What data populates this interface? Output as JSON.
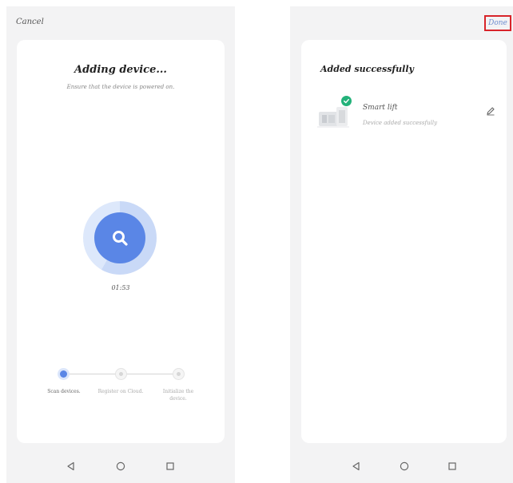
{
  "left_screen": {
    "cancel_label": "Cancel",
    "title": "Adding device...",
    "subtitle": "Ensure that the device is powered on.",
    "timer": "01:53",
    "steps": [
      {
        "label": "Scan devices.",
        "state": "active"
      },
      {
        "label": "Register on Cloud.",
        "state": "pending"
      },
      {
        "label": "Initialize the device.",
        "state": "pending"
      }
    ]
  },
  "right_screen": {
    "done_label": "Done",
    "title": "Added successfully",
    "device": {
      "name": "Smart lift",
      "status": "Device added successfully"
    }
  },
  "icons": {
    "scan": "magnifier-icon",
    "success": "check-circle-icon",
    "edit": "pencil-icon",
    "nav": [
      "back-triangle-icon",
      "home-circle-icon",
      "recent-square-icon"
    ]
  },
  "colors": {
    "accent": "#5a86e6",
    "success": "#23b27a",
    "highlight_box": "#d8242a",
    "done_text": "#6f8fd0"
  }
}
